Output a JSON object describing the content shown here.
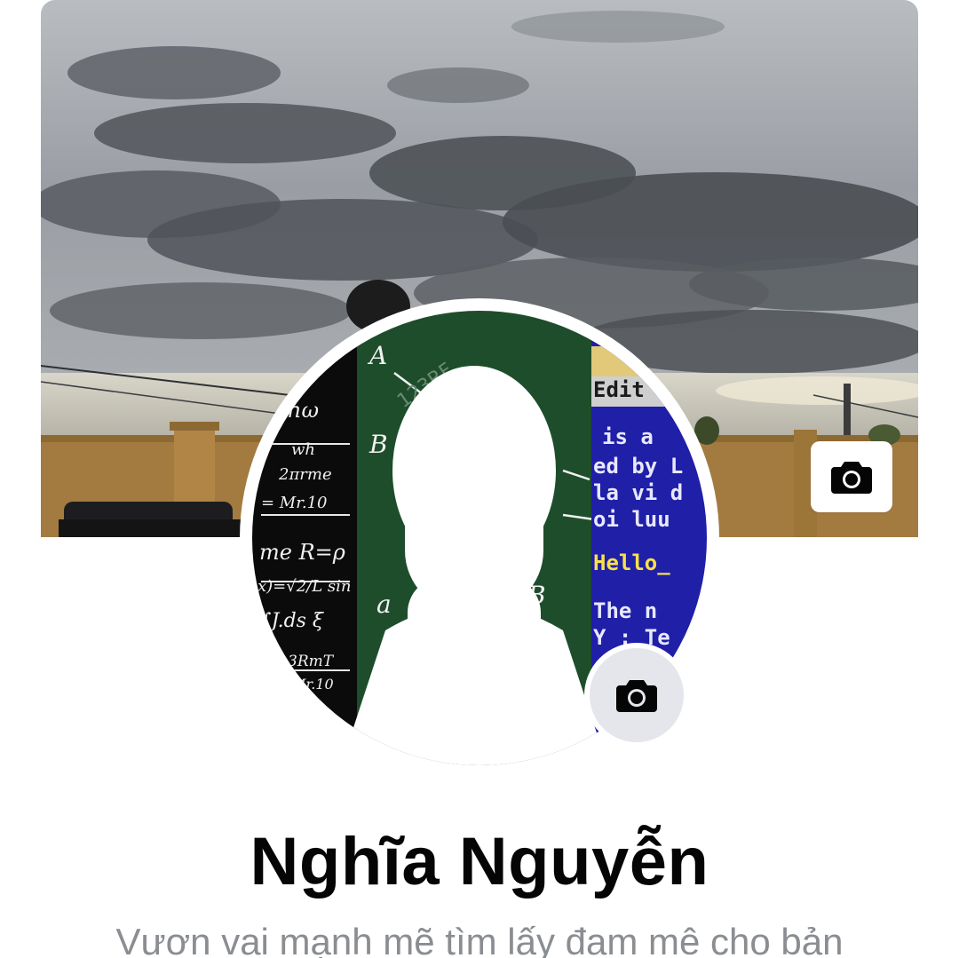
{
  "profile": {
    "name": "Nghĩa Nguyễn",
    "bio": "Vươn vai mạnh mẽ tìm lấy đam mê cho bản"
  },
  "avatar": {
    "panel_texts": {
      "edit_label": "Edit",
      "code_line_1": "is a",
      "code_line_2": "ed by L",
      "code_line_3": "la vi d",
      "code_line_4": "oi luu",
      "code_line_5": "Hello_",
      "code_line_6": "The n",
      "code_line_7": "Y : Te",
      "watermark": "123RF"
    }
  },
  "icons": {
    "cover_camera": "camera-icon",
    "avatar_camera": "camera-icon"
  },
  "colors": {
    "background": "#ffffff",
    "name_text": "#050505",
    "bio_text": "#8a8d91",
    "camera_button_gray": "#e4e6eb",
    "code_panel_blue": "#1f1fa8",
    "code_highlight_yellow": "#f7e14a",
    "chalkboard_green": "#1e4d2b"
  }
}
